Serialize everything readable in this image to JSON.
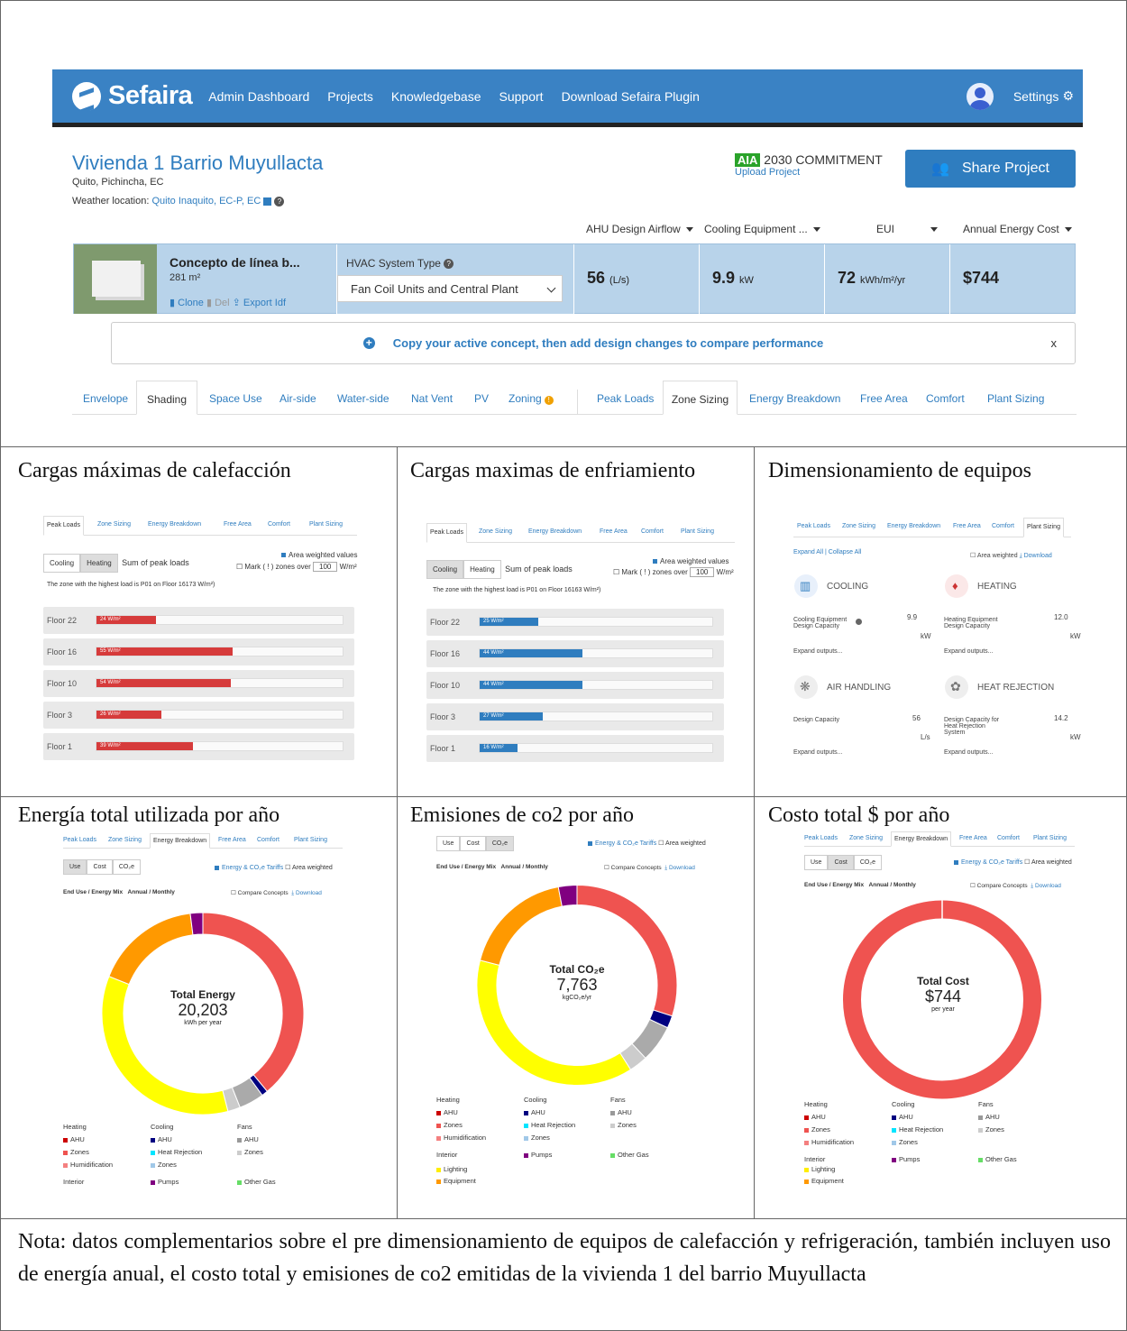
{
  "nav": {
    "logo": "Sefaira",
    "links": [
      "Admin Dashboard",
      "Projects",
      "Knowledgebase",
      "Support",
      "Download Sefaira Plugin"
    ],
    "settings": "Settings"
  },
  "project": {
    "title": "Vivienda 1 Barrio Muyullacta",
    "location": "Quito, Pichincha, EC",
    "weather_label": "Weather location:",
    "weather_value": "Quito Inaquito, EC-P, EC",
    "aia_badge": "AIA",
    "aia_text": "2030 COMMITMENT",
    "upload": "Upload Project",
    "share": "Share Project"
  },
  "metrics_headers": [
    "AHU Design Airflow",
    "Cooling Equipment ...",
    "EUI",
    "Annual Energy Cost"
  ],
  "concept": {
    "name": "Concepto de línea b...",
    "area": "281 m²",
    "clone": "Clone",
    "del": "Del",
    "export": "Export Idf",
    "hvac_label": "HVAC System Type",
    "hvac_value": "Fan Coil Units and Central Plant",
    "m1": "56",
    "m1u": "(L/s)",
    "m2": "9.9",
    "m2u": "kW",
    "m3": "72",
    "m3u": "kWh/m²/yr",
    "m4": "$744"
  },
  "banner": {
    "text": "Copy your active concept, then add design changes to compare performance",
    "close": "x"
  },
  "tabs": [
    "Envelope",
    "Shading",
    "Space Use",
    "Air-side",
    "Water-side",
    "Nat Vent",
    "PV",
    "Zoning",
    "Peak Loads",
    "Zone Sizing",
    "Energy Breakdown",
    "Free Area",
    "Comfort",
    "Plant Sizing"
  ],
  "cells": {
    "c1": "Cargas máximas de calefacción",
    "c2": "Cargas maximas de enfriamiento",
    "c3": "Dimensionamiento de equipos",
    "c4": "Energía total utilizada por año",
    "c5": "Emisiones de co2 por año",
    "c6": "Costo total $ por año"
  },
  "mini_tabs": [
    "Peak Loads",
    "Zone Sizing",
    "Energy Breakdown",
    "Free Area",
    "Comfort",
    "Plant Sizing"
  ],
  "loads": {
    "cooling": "Cooling",
    "heating": "Heating",
    "sum": "Sum of peak loads",
    "area_weighted": "Area weighted values",
    "mark": "Mark ( ! ) zones over",
    "mark_val": "100",
    "mark_unit": "W/m²",
    "heating_note": "The zone with the highest load is P01 on Floor 16173 W/m²)",
    "cooling_note": "The zone with the highest load is P01 on Floor 16163 W/m²)",
    "floors": [
      "Floor 22",
      "Floor 16",
      "Floor 10",
      "Floor 3",
      "Floor 1"
    ],
    "heating_vals": [
      24,
      55,
      54,
      26,
      39
    ],
    "heating_labels": [
      "24 W/m²",
      "55 W/m²",
      "54 W/m²",
      "26 W/m²",
      "39 W/m²"
    ],
    "cooling_vals": [
      25,
      44,
      44,
      27,
      16
    ],
    "cooling_labels": [
      "25 W/m²",
      "44 W/m²",
      "44 W/m²",
      "27 W/m²",
      "16 W/m²"
    ],
    "colors": {
      "heating": "#d63b3b",
      "cooling": "#2f7dbf"
    }
  },
  "plant": {
    "expand_all": "Expand All | Collapse All",
    "area_weighted": "Area weighted",
    "download": "Download",
    "cooling": "COOLING",
    "heating": "HEATING",
    "air": "AIR HANDLING",
    "rejection": "HEAT REJECTION",
    "cool_lbl": "Cooling Equipment Design Capacity",
    "cool_val": "9.9",
    "cool_unit": "kW",
    "heat_lbl": "Heating Equipment Design Capacity",
    "heat_val": "12.0",
    "heat_unit": "kW",
    "air_lbl": "Design Capacity",
    "air_val": "56",
    "air_unit": "L/s",
    "rej_lbl": "Design Capacity for Heat Rejection System",
    "rej_val": "14.2",
    "rej_unit": "kW",
    "expand": "Expand outputs..."
  },
  "donut_ui": {
    "use": "Use",
    "cost": "Cost",
    "co2": "CO₂e",
    "tariffs": "Energy & CO₂e Tariffs",
    "area_weighted": "Area weighted",
    "enduse": "End Use / Energy Mix",
    "annual": "Annual / Monthly",
    "compare": "Compare Concepts",
    "download": "Download"
  },
  "donuts": {
    "energy": {
      "title": "Total Energy",
      "value": "20,203",
      "unit": "kWh per year"
    },
    "co2": {
      "title": "Total CO₂e",
      "value": "7,763",
      "unit": "kgCO₂e/yr"
    },
    "cost": {
      "title": "Total Cost",
      "value": "$744",
      "unit": "per year"
    }
  },
  "chart_data": [
    {
      "type": "pie",
      "title": "Total Energy",
      "categories": [
        "Zones",
        "Heat Rejection",
        "AHU fans",
        "Zones fans",
        "Lighting",
        "Equipment",
        "Pumps"
      ],
      "values": [
        39,
        1,
        4,
        2,
        35,
        17,
        2
      ],
      "colors": [
        "#ef5350",
        "#000080",
        "#aaaaaa",
        "#cccccc",
        "#ffff00",
        "#ff9900",
        "#800080"
      ]
    },
    {
      "type": "pie",
      "title": "Total CO₂e",
      "categories": [
        "Zones",
        "Heat Rejection",
        "AHU fans",
        "Zones fans",
        "Lighting",
        "Equipment",
        "Pumps"
      ],
      "values": [
        30,
        2,
        6,
        3,
        38,
        18,
        3
      ],
      "colors": [
        "#ef5350",
        "#000080",
        "#aaaaaa",
        "#cccccc",
        "#ffff00",
        "#ff9900",
        "#800080"
      ]
    },
    {
      "type": "pie",
      "title": "Total Cost",
      "categories": [
        "Zones"
      ],
      "values": [
        100
      ],
      "colors": [
        "#ef5350"
      ]
    }
  ],
  "legend": {
    "heating": "Heating",
    "cooling": "Cooling",
    "fans": "Fans",
    "interior": "Interior",
    "items": [
      {
        "label": "AHU",
        "color": "#cc0000"
      },
      {
        "label": "Zones",
        "color": "#ef5350"
      },
      {
        "label": "Humidification",
        "color": "#f48080"
      },
      {
        "label": "AHU",
        "color": "#000080"
      },
      {
        "label": "Heat Rejection",
        "color": "#00e5ff"
      },
      {
        "label": "Zones",
        "color": "#a0c8e8"
      },
      {
        "label": "AHU",
        "color": "#999999"
      },
      {
        "label": "Zones",
        "color": "#cccccc"
      },
      {
        "label": "Lighting",
        "color": "#ffee00"
      },
      {
        "label": "Equipment",
        "color": "#ff9900"
      },
      {
        "label": "Pumps",
        "color": "#800080"
      },
      {
        "label": "Other Gas",
        "color": "#66dd66"
      }
    ]
  },
  "note": "Nota: datos complementarios sobre el pre dimensionamiento de equipos de calefacción y refrigeración, también incluyen uso de energía anual, el costo total y emisiones de co2 emitidas de la vivienda 1 del barrio Muyullacta"
}
